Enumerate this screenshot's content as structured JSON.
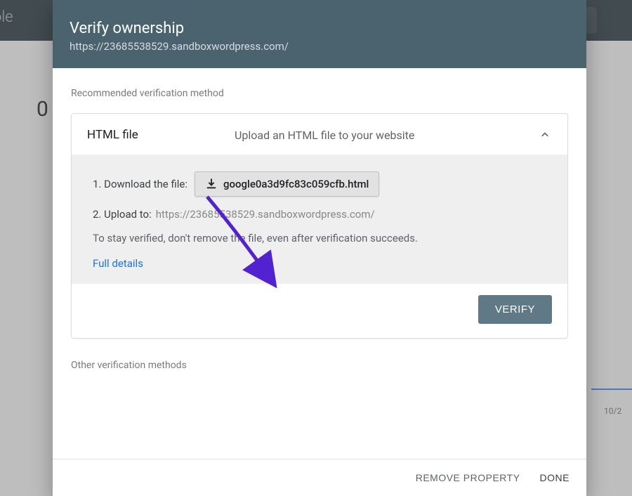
{
  "bg": {
    "logo_fragment": "ole",
    "big_o": "0",
    "tick": "10/2"
  },
  "modal": {
    "title": "Verify ownership",
    "subtitle": "https://23685538529.sandboxwordpress.com/",
    "recommended_label": "Recommended verification method",
    "method": {
      "name": "HTML file",
      "desc": "Upload an HTML file to your website",
      "step1_prefix": "1. Download the file:",
      "download_filename": "google0a3d9fc83c059cfb.html",
      "step2_prefix": "2. Upload to:",
      "step2_url": "https://23685538529.sandboxwordpress.com/",
      "note": "To stay verified, don't remove the file, even after verification succeeds.",
      "details_link": "Full details",
      "verify_label": "VERIFY"
    },
    "other_label": "Other verification methods",
    "footer": {
      "remove_label": "REMOVE PROPERTY",
      "done_label": "DONE"
    }
  }
}
